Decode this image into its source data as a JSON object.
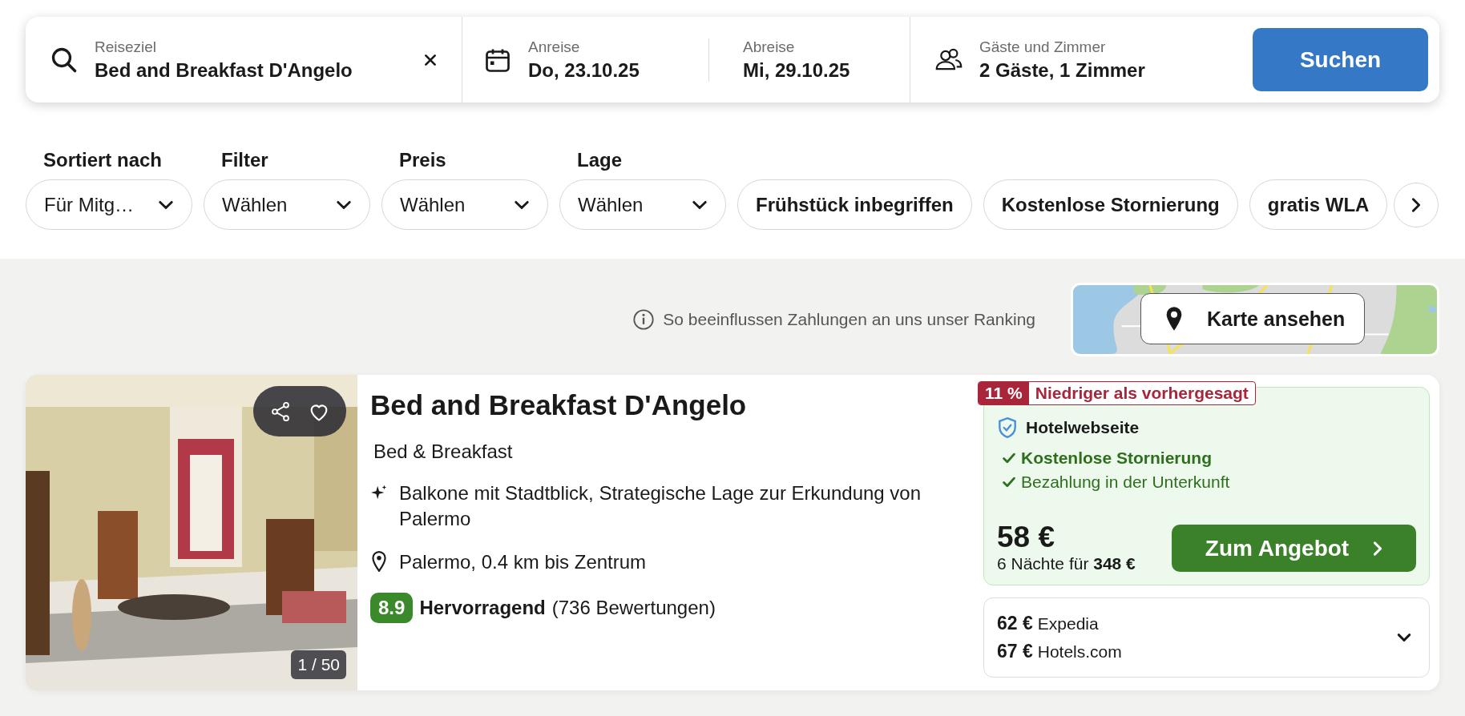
{
  "search": {
    "destination": {
      "label": "Reiseziel",
      "value": "Bed and Breakfast D'Angelo"
    },
    "checkin": {
      "label": "Anreise",
      "value": "Do, 23.10.25"
    },
    "checkout": {
      "label": "Abreise",
      "value": "Mi, 29.10.25"
    },
    "guests": {
      "label": "Gäste und Zimmer",
      "value": "2 Gäste, 1 Zimmer"
    },
    "button": "Suchen"
  },
  "filters": [
    {
      "kind": "dropdown",
      "label": "Sortiert nach",
      "value": "Für Mitg…"
    },
    {
      "kind": "dropdown",
      "label": "Filter",
      "value": "Wählen"
    },
    {
      "kind": "dropdown",
      "label": "Preis",
      "value": "Wählen"
    },
    {
      "kind": "dropdown",
      "label": "Lage",
      "value": "Wählen"
    },
    {
      "kind": "chip",
      "label": "Frühstück inbegriffen",
      "selected": false
    },
    {
      "kind": "chip",
      "label": "Kostenlose Stornierung",
      "selected": false
    },
    {
      "kind": "chip",
      "label": "gratis WLA",
      "selected": false
    }
  ],
  "ranking_note": "So beeinflussen Zahlungen an uns unser Ranking",
  "map_button": "Karte ansehen",
  "hotel": {
    "photo_counter": "1 / 50",
    "name": "Bed and Breakfast D'Angelo",
    "type": "Bed & Breakfast",
    "highlights": "Balkone mit Stadtblick, Strategische Lage zur Erkundung von Palermo",
    "location": "Palermo, 0.4 km bis Zentrum",
    "rating": {
      "score": "8.9",
      "label": "Hervorragend",
      "reviews": "(736 Bewertungen)"
    }
  },
  "deal": {
    "discount": "11 %",
    "discount_label": "Niedriger als vorhergesagt",
    "provider": "Hotelwebseite",
    "perks": [
      {
        "text": "Kostenlose Stornierung",
        "bold": true
      },
      {
        "text": "Bezahlung in der Unterkunft",
        "bold": false
      }
    ],
    "price": "58 €",
    "total": "6 Nächte für **348 €**",
    "button": "Zum Angebot"
  },
  "other_offers": {
    "expanded": false,
    "items": [
      {
        "price": "62 €",
        "provider": "Expedia"
      },
      {
        "price": "67 €",
        "provider": "Hotels.com"
      }
    ]
  }
}
